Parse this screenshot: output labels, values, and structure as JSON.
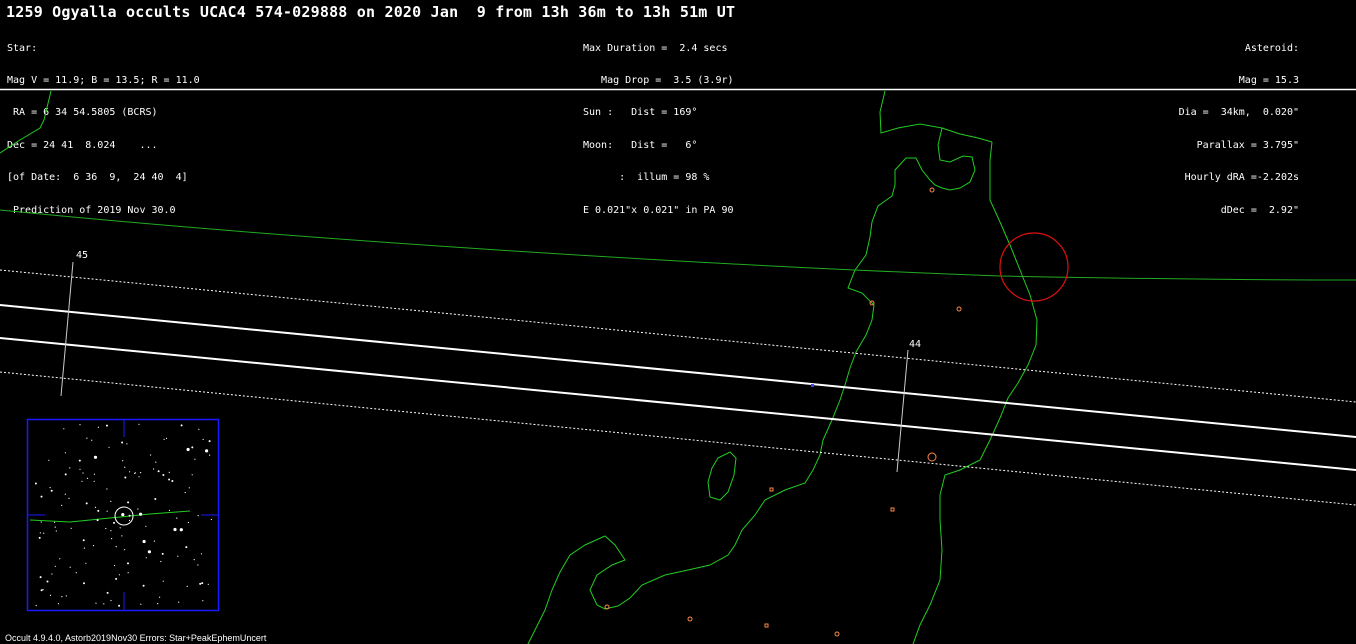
{
  "header": {
    "title": "1259 Ogyalla occults UCAC4 574-029888 on 2020 Jan  9 from 13h 36m to 13h 51m UT"
  },
  "star_info": {
    "lines": [
      "Star:",
      "Mag V = 11.9; B = 13.5; R = 11.0",
      " RA = 6 34 54.5805 (BCRS)",
      "Dec = 24 41  8.024    ...",
      "[of Date:  6 36  9,  24 40  4]",
      " Prediction of 2019 Nov 30.0"
    ]
  },
  "event_info": {
    "lines": [
      "Max Duration =  2.4 secs",
      "   Mag Drop =  3.5 (3.9r)",
      "Sun :   Dist = 169°",
      "Moon:   Dist =   6°",
      "      :  illum = 98 %",
      "E 0.021\"x 0.021\" in PA 90"
    ]
  },
  "asteroid_info": {
    "lines": [
      "Asteroid:",
      "Mag = 15.3",
      "Dia =  34km,  0.020\"",
      "Parallax = 3.795\"",
      "Hourly dRA =-2.202s",
      "dDec =  2.92\""
    ]
  },
  "map": {
    "time_labels": [
      "45",
      "44"
    ],
    "colors": {
      "background": "#000000",
      "coastline": "#22cc22",
      "path": "#ffffff",
      "uncertainty": "#ffffff",
      "highlight_circle": "#dd1111",
      "city": "#ff8844",
      "starchart_frame": "#1a1aff"
    }
  },
  "footer": {
    "text": "Occult 4.9.4.0, Astorb2019Nov30 Errors: Star+PeakEphemUncert"
  }
}
